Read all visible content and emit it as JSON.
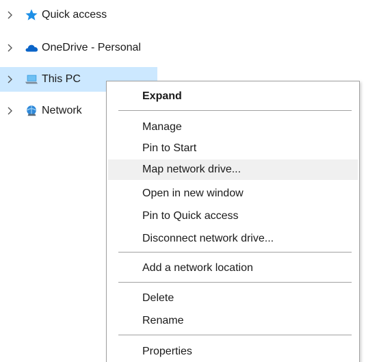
{
  "nav": {
    "items": [
      {
        "label": "Quick access",
        "icon": "star-icon",
        "selected": false
      },
      {
        "label": "OneDrive - Personal",
        "icon": "cloud-icon",
        "selected": false
      },
      {
        "label": "This PC",
        "icon": "computer-icon",
        "selected": true
      },
      {
        "label": "Network",
        "icon": "network-icon",
        "selected": false
      }
    ]
  },
  "context_menu": {
    "expand": "Expand",
    "manage": "Manage",
    "pin_to_start": "Pin to Start",
    "map_network_drive": "Map network drive...",
    "open_new_window": "Open in new window",
    "pin_quick_access": "Pin to Quick access",
    "disconnect_network_drive": "Disconnect network drive...",
    "add_network_location": "Add a network location",
    "delete": "Delete",
    "rename": "Rename",
    "properties": "Properties",
    "hovered_item": "Map network drive..."
  },
  "colors": {
    "selection": "#cce8ff",
    "hover": "#f0f0f0",
    "star": "#1e90ff",
    "onedrive": "#0a64c8"
  }
}
